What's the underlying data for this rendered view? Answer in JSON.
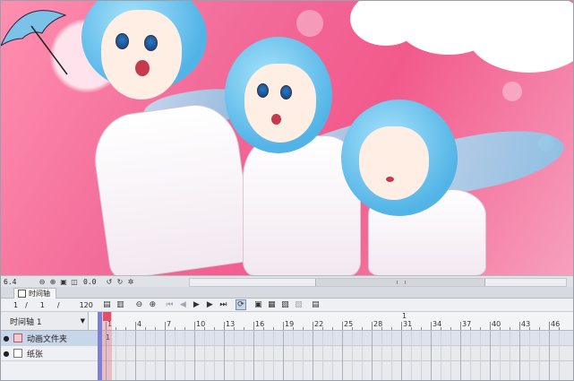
{
  "statusbar": {
    "zoom": "6.4",
    "rotation": "0.0",
    "icons": [
      "zoom-out-icon",
      "zoom-in-icon",
      "actual-size-icon",
      "fit-icon",
      "rotate-left-icon",
      "rotate-right-icon",
      "settings-icon"
    ]
  },
  "panel": {
    "tab_label": "时间轴"
  },
  "toolbar": {
    "current_frame": "1",
    "sep1": "/",
    "frame2": "1",
    "sep2": "/",
    "total_frames": "120",
    "icons": [
      "new-timeline-icon",
      "new-folder-icon",
      "zoom-out-icon",
      "zoom-in-icon",
      "first-frame-icon",
      "prev-frame-icon",
      "play-icon",
      "next-frame-icon",
      "last-frame-icon",
      "loop-icon",
      "layer-settings-icon",
      "cel-icon",
      "cel-add-icon",
      "onion-skin-icon",
      "export-icon"
    ]
  },
  "timeline": {
    "name": "时间轴 1",
    "ruler_labels": [
      "1",
      "4",
      "7",
      "10",
      "13",
      "16",
      "19",
      "22",
      "25",
      "28",
      "31",
      "34",
      "37",
      "40",
      "43",
      "46"
    ],
    "ruler_top": [
      {
        "frame": 1,
        "label": "1"
      },
      {
        "frame": 31,
        "label": "1"
      }
    ],
    "layers": [
      {
        "name": "动画文件夹",
        "type": "folder",
        "selected": true,
        "visible": true,
        "cell_value": "1"
      },
      {
        "name": "纸张",
        "type": "paper",
        "selected": false,
        "visible": true,
        "cell_value": ""
      }
    ]
  },
  "colors": {
    "accent": "#e0506b",
    "selection": "#c8d6ea",
    "panel_bg": "#eef0f3"
  }
}
